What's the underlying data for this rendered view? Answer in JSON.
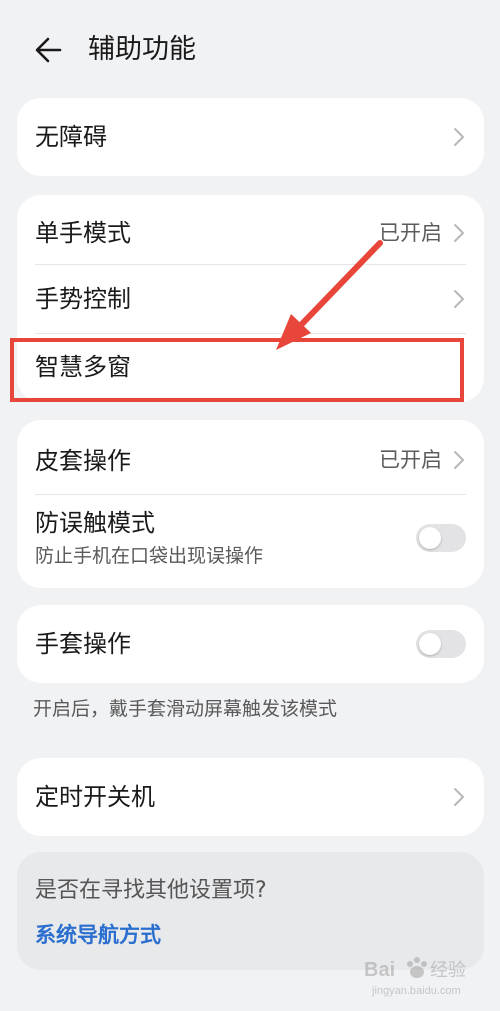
{
  "header": {
    "title": "辅助功能",
    "back_icon": "back-arrow-icon"
  },
  "card_accessibility": {
    "label": "无障碍"
  },
  "card_modes": {
    "one_hand": {
      "label": "单手模式",
      "value": "已开启"
    },
    "gesture": {
      "label": "手势控制"
    },
    "smart_multiwindow": {
      "label": "智慧多窗"
    }
  },
  "card_cover": {
    "cover_op": {
      "label": "皮套操作",
      "value": "已开启"
    },
    "mistouch": {
      "label": "防误触模式",
      "sublabel": "防止手机在口袋出现误操作",
      "enabled": false
    }
  },
  "card_glove": {
    "label": "手套操作",
    "enabled": false
  },
  "glove_note": "开启后，戴手套滑动屏幕触发该模式",
  "card_timer": {
    "label": "定时开关机"
  },
  "suggest": {
    "question": "是否在寻找其他设置项?",
    "link": "系统导航方式"
  },
  "annotation": {
    "color": "#e8463a"
  },
  "colors": {
    "background": "#f1f2f4",
    "card": "#ffffff",
    "link": "#2a6fcf"
  }
}
